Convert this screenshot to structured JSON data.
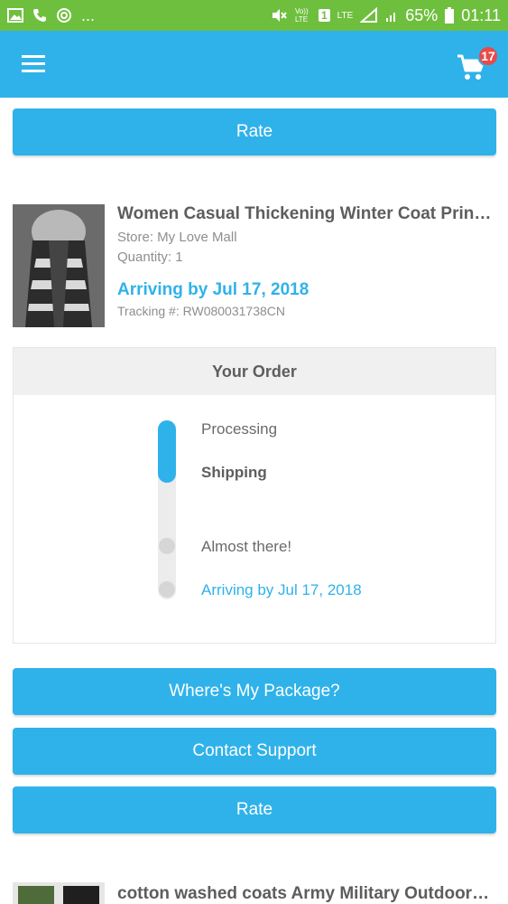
{
  "status_bar": {
    "left_text": "...",
    "battery": "65%",
    "time": "01:11",
    "network_1": "Vo)) LTE",
    "network_2": "LTE",
    "sim": "1"
  },
  "app_bar": {
    "menu_icon": "hamburger-menu-icon",
    "cart_icon": "shopping-cart-icon",
    "cart_count": "17"
  },
  "top_rate_button": {
    "label": "Rate"
  },
  "product_1": {
    "title": "Women Casual Thickening Winter Coat Printin...",
    "store": "Store: My Love Mall",
    "quantity": "Quantity: 1",
    "arriving": "Arriving by Jul 17, 2018",
    "tracking": "Tracking #: RW080031738CN"
  },
  "order": {
    "header": "Your Order",
    "progress_fraction": 0.35,
    "steps": [
      {
        "label": "Processing"
      },
      {
        "label": "Shipping"
      },
      {
        "label": "Almost there!"
      },
      {
        "label": "Arriving by Jul 17, 2018"
      }
    ]
  },
  "actions": {
    "wheres_package": "Where's My Package?",
    "contact_support": "Contact Support",
    "rate": "Rate"
  },
  "product_2": {
    "title": "cotton washed coats Army Military Outdoors S..."
  },
  "colors": {
    "accent": "#2fb2ea",
    "status_bar": "#6fbf3e",
    "badge": "#e94a4a"
  }
}
